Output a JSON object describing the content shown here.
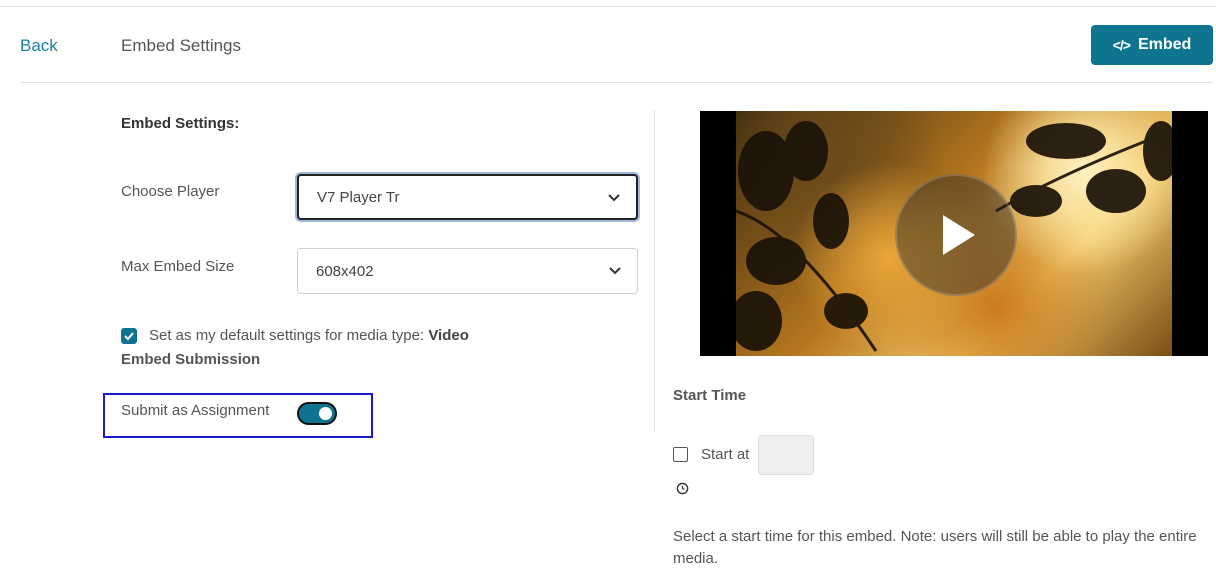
{
  "header": {
    "back_label": "Back",
    "title": "Embed Settings",
    "embed_button_label": "Embed",
    "embed_button_icon": "code-icon"
  },
  "settings": {
    "section_title": "Embed Settings:",
    "choose_player_label": "Choose Player",
    "choose_player_value": "V7 Player Tr",
    "max_embed_size_label": "Max Embed Size",
    "max_embed_size_value": "608x402",
    "default_checkbox_checked": true,
    "default_text_prefix": "Set as my default settings for media type:",
    "default_media_type": "Video",
    "submission_heading": "Embed Submission",
    "submit_assignment_label": "Submit as Assignment",
    "submit_assignment_on": true
  },
  "preview": {
    "play_icon": "play-icon",
    "start_time_title": "Start Time",
    "start_at_label": "Start at",
    "start_at_checked": false,
    "start_at_value": "",
    "clock_icon": "clock-icon",
    "help_text": "Select a start time for this embed. Note: users will still be able to play the entire media."
  },
  "colors": {
    "accent": "#0e7490",
    "link": "#1a7fa6",
    "highlight_border": "#1a1acc"
  }
}
